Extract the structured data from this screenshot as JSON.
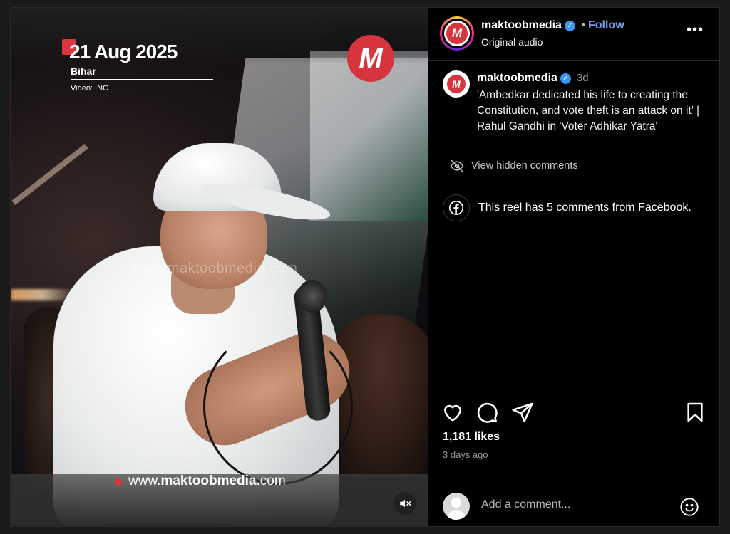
{
  "reel": {
    "date": "21 Aug 2025",
    "place": "Bihar",
    "credit": "Video: INC",
    "brand_mark": "M",
    "watermark": "www.maktoobmedia.com",
    "site_url_prefix": "www.",
    "site_url_brand": "maktoobmedia",
    "site_url_suffix": ".com"
  },
  "header": {
    "username": "maktoobmedia",
    "separator": "•",
    "follow_label": "Follow",
    "audio": "Original audio",
    "more_label": "•••"
  },
  "caption": {
    "username": "maktoobmedia",
    "time": "3d",
    "text": "'Ambedkar dedicated his life to creating the Constitution, and vote theft is an attack on it' | Rahul Gandhi in 'Voter Adhikar Yatra'"
  },
  "comments": {
    "hidden_label": "View hidden comments",
    "facebook_note": "This reel has 5 comments from Facebook."
  },
  "stats": {
    "likes": "1,181 likes",
    "posted": "3 days ago"
  },
  "comment_box": {
    "placeholder": "Add a comment..."
  },
  "colors": {
    "brand_red": "#d7353d",
    "follow_blue": "#7c9ef2",
    "verified_blue": "#3897f0"
  },
  "icons": [
    "verified-badge-icon",
    "more-options-icon",
    "eye-slash-icon",
    "facebook-icon",
    "heart-icon",
    "comment-icon",
    "share-icon",
    "bookmark-icon",
    "emoji-icon",
    "muted-speaker-icon"
  ]
}
